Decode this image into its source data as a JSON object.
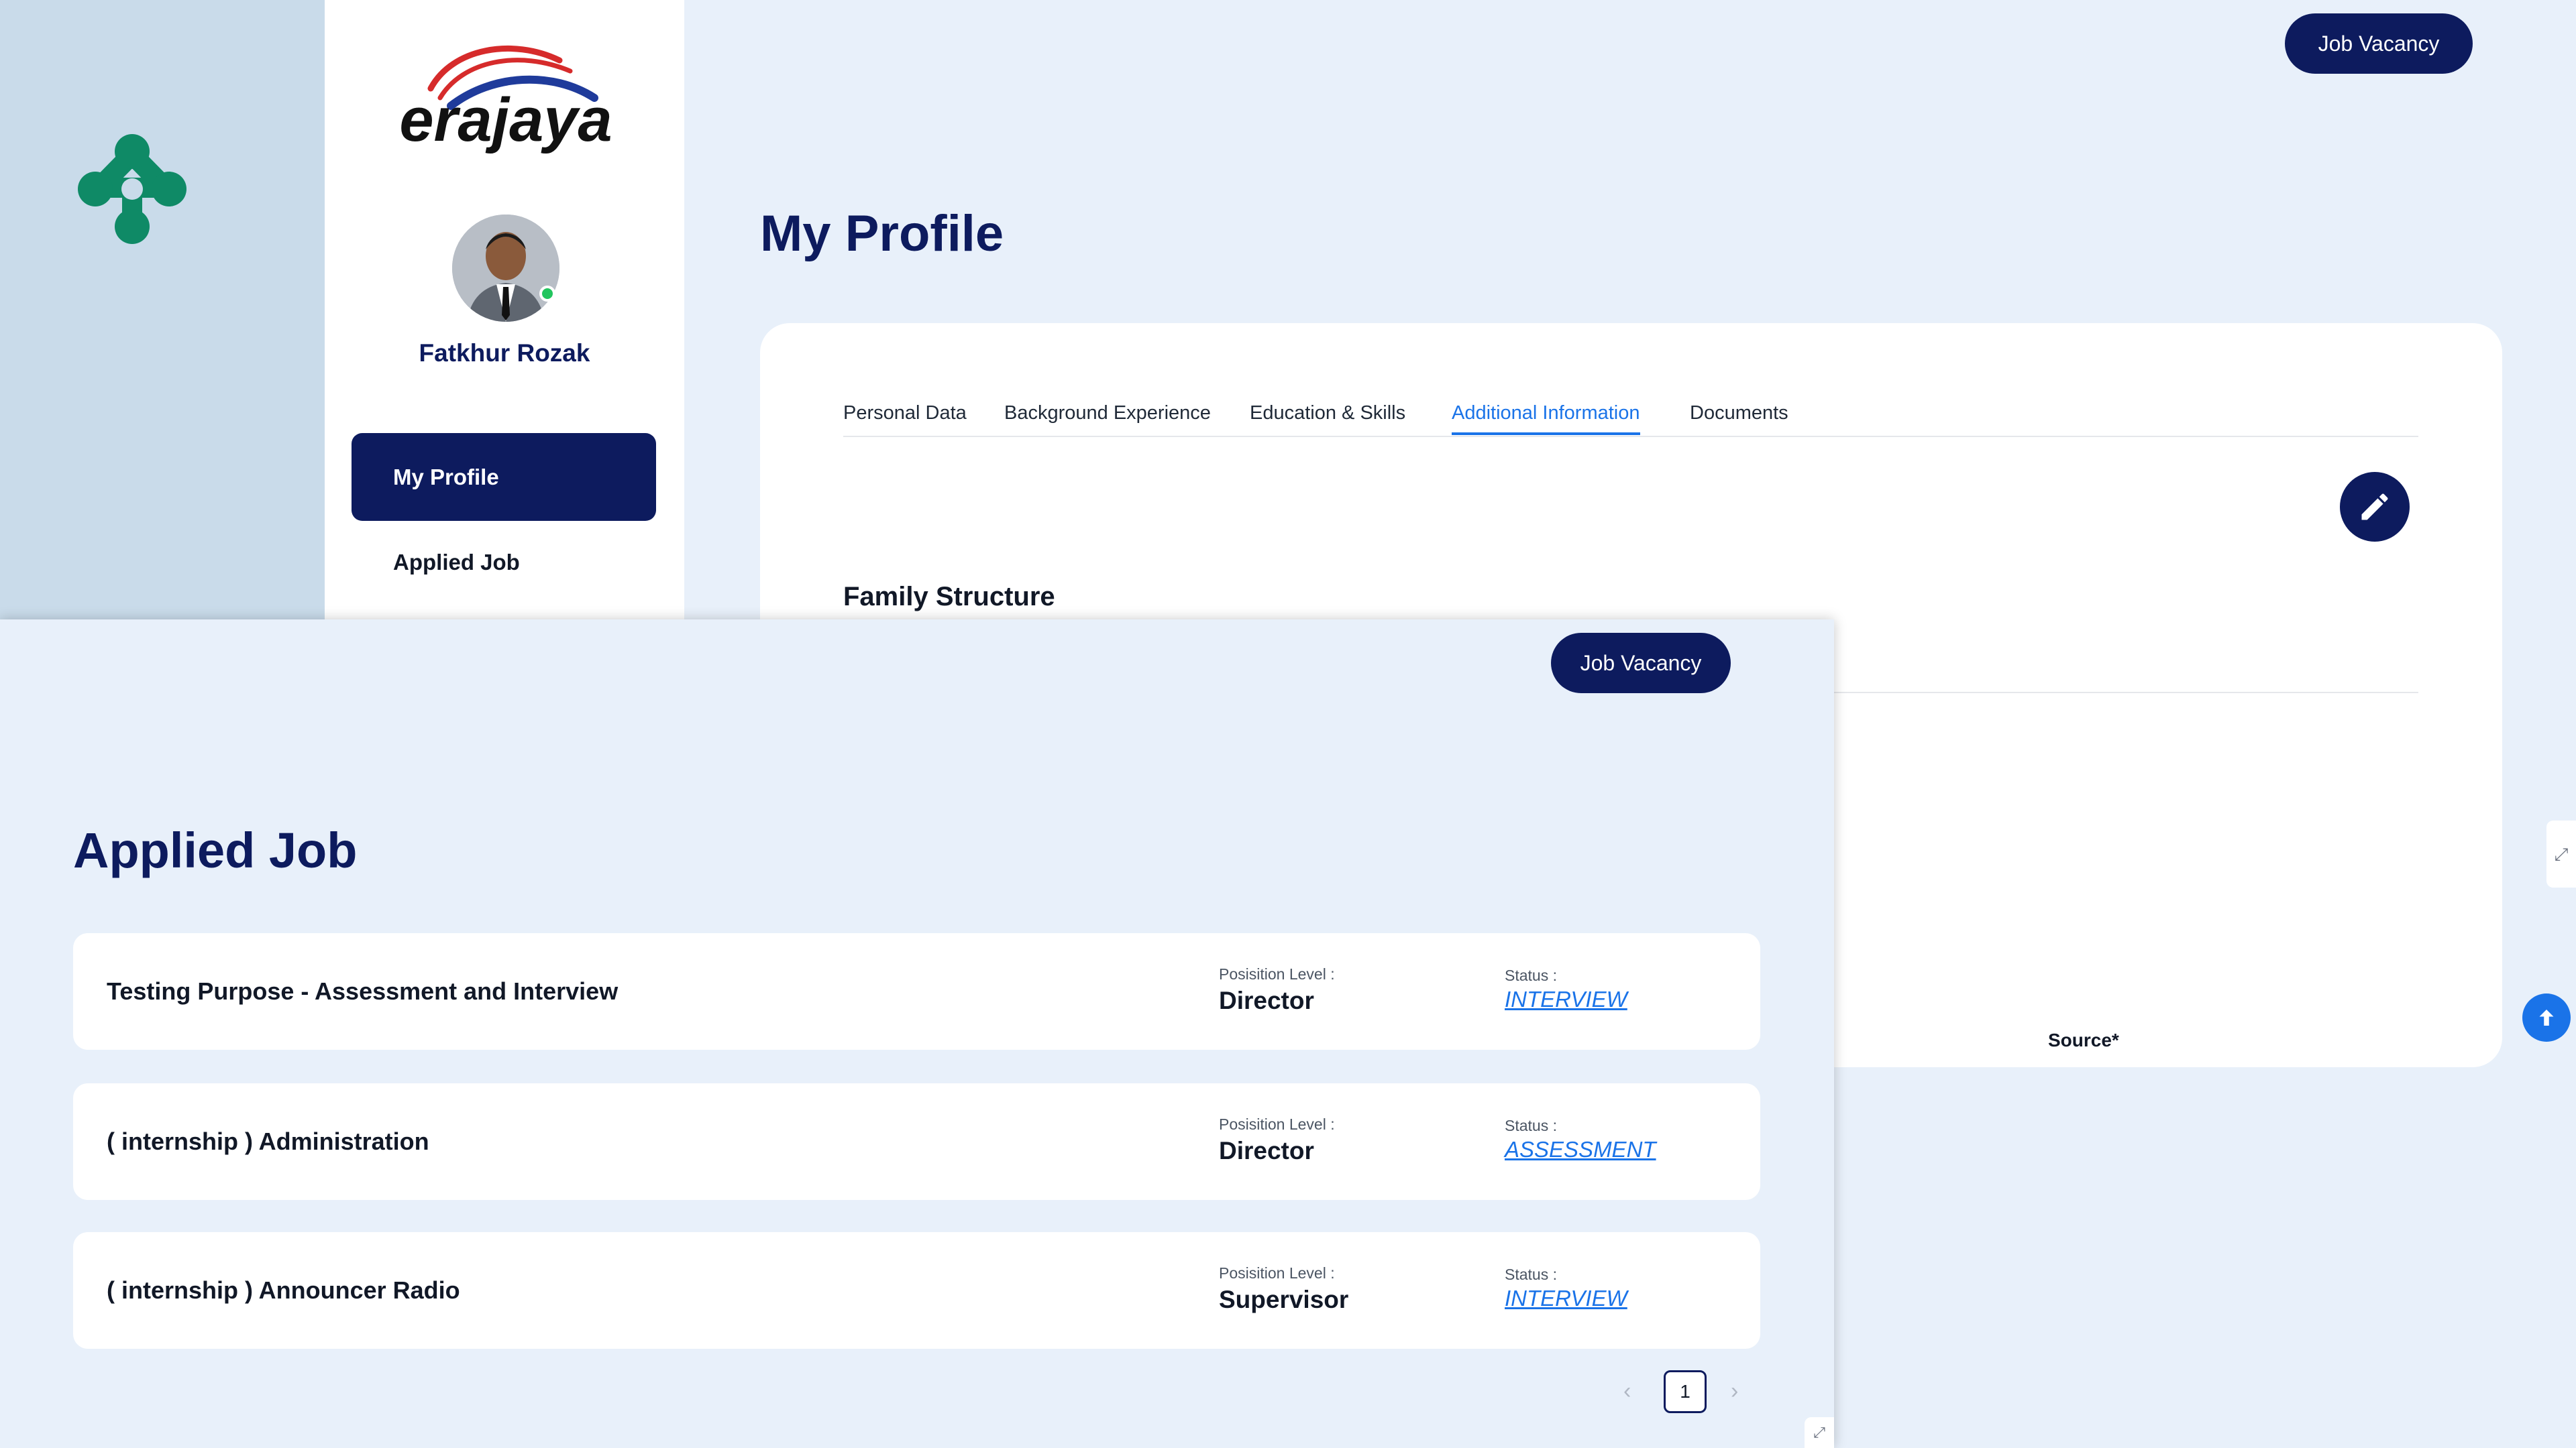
{
  "brand": {
    "logo_icon": "company-network-logo",
    "logo_color": "#0f8a66"
  },
  "sidebar": {
    "logo_text": "erajaya",
    "user_name": "Fatkhur Rozak",
    "status_color": "#22c55e",
    "nav": [
      {
        "label": "My Profile",
        "active": true
      },
      {
        "label": "Applied Job",
        "active": false
      }
    ]
  },
  "profile": {
    "job_vacancy_label": "Job Vacancy",
    "title": "My Profile",
    "tabs": [
      {
        "label": "Personal Data",
        "active": false
      },
      {
        "label": "Background Experience",
        "active": false
      },
      {
        "label": "Education & Skills",
        "active": false
      },
      {
        "label": "Additional Information",
        "active": true
      },
      {
        "label": "Documents",
        "active": false
      }
    ],
    "edit_icon": "pencil-icon",
    "section_title": "Family Structure",
    "source_label": "Source*"
  },
  "applied": {
    "job_vacancy_label": "Job Vacancy",
    "title": "Applied Job",
    "level_label": "Posisition Level :",
    "status_label": "Status :",
    "jobs": [
      {
        "title": "Testing Purpose - Assessment and Interview",
        "level": "Director",
        "status": "INTERVIEW"
      },
      {
        "title": "( internship ) Administration",
        "level": "Director",
        "status": "ASSESSMENT"
      },
      {
        "title": "( internship ) Announcer Radio",
        "level": "Supervisor",
        "status": "INTERVIEW"
      }
    ],
    "pagination": {
      "current_page": "1",
      "prev_icon": "chevron-left-icon",
      "next_icon": "chevron-right-icon"
    }
  },
  "colors": {
    "navy": "#0d1b5e",
    "accent_blue": "#1a73e8",
    "panel_bg": "#e8f0fa"
  }
}
